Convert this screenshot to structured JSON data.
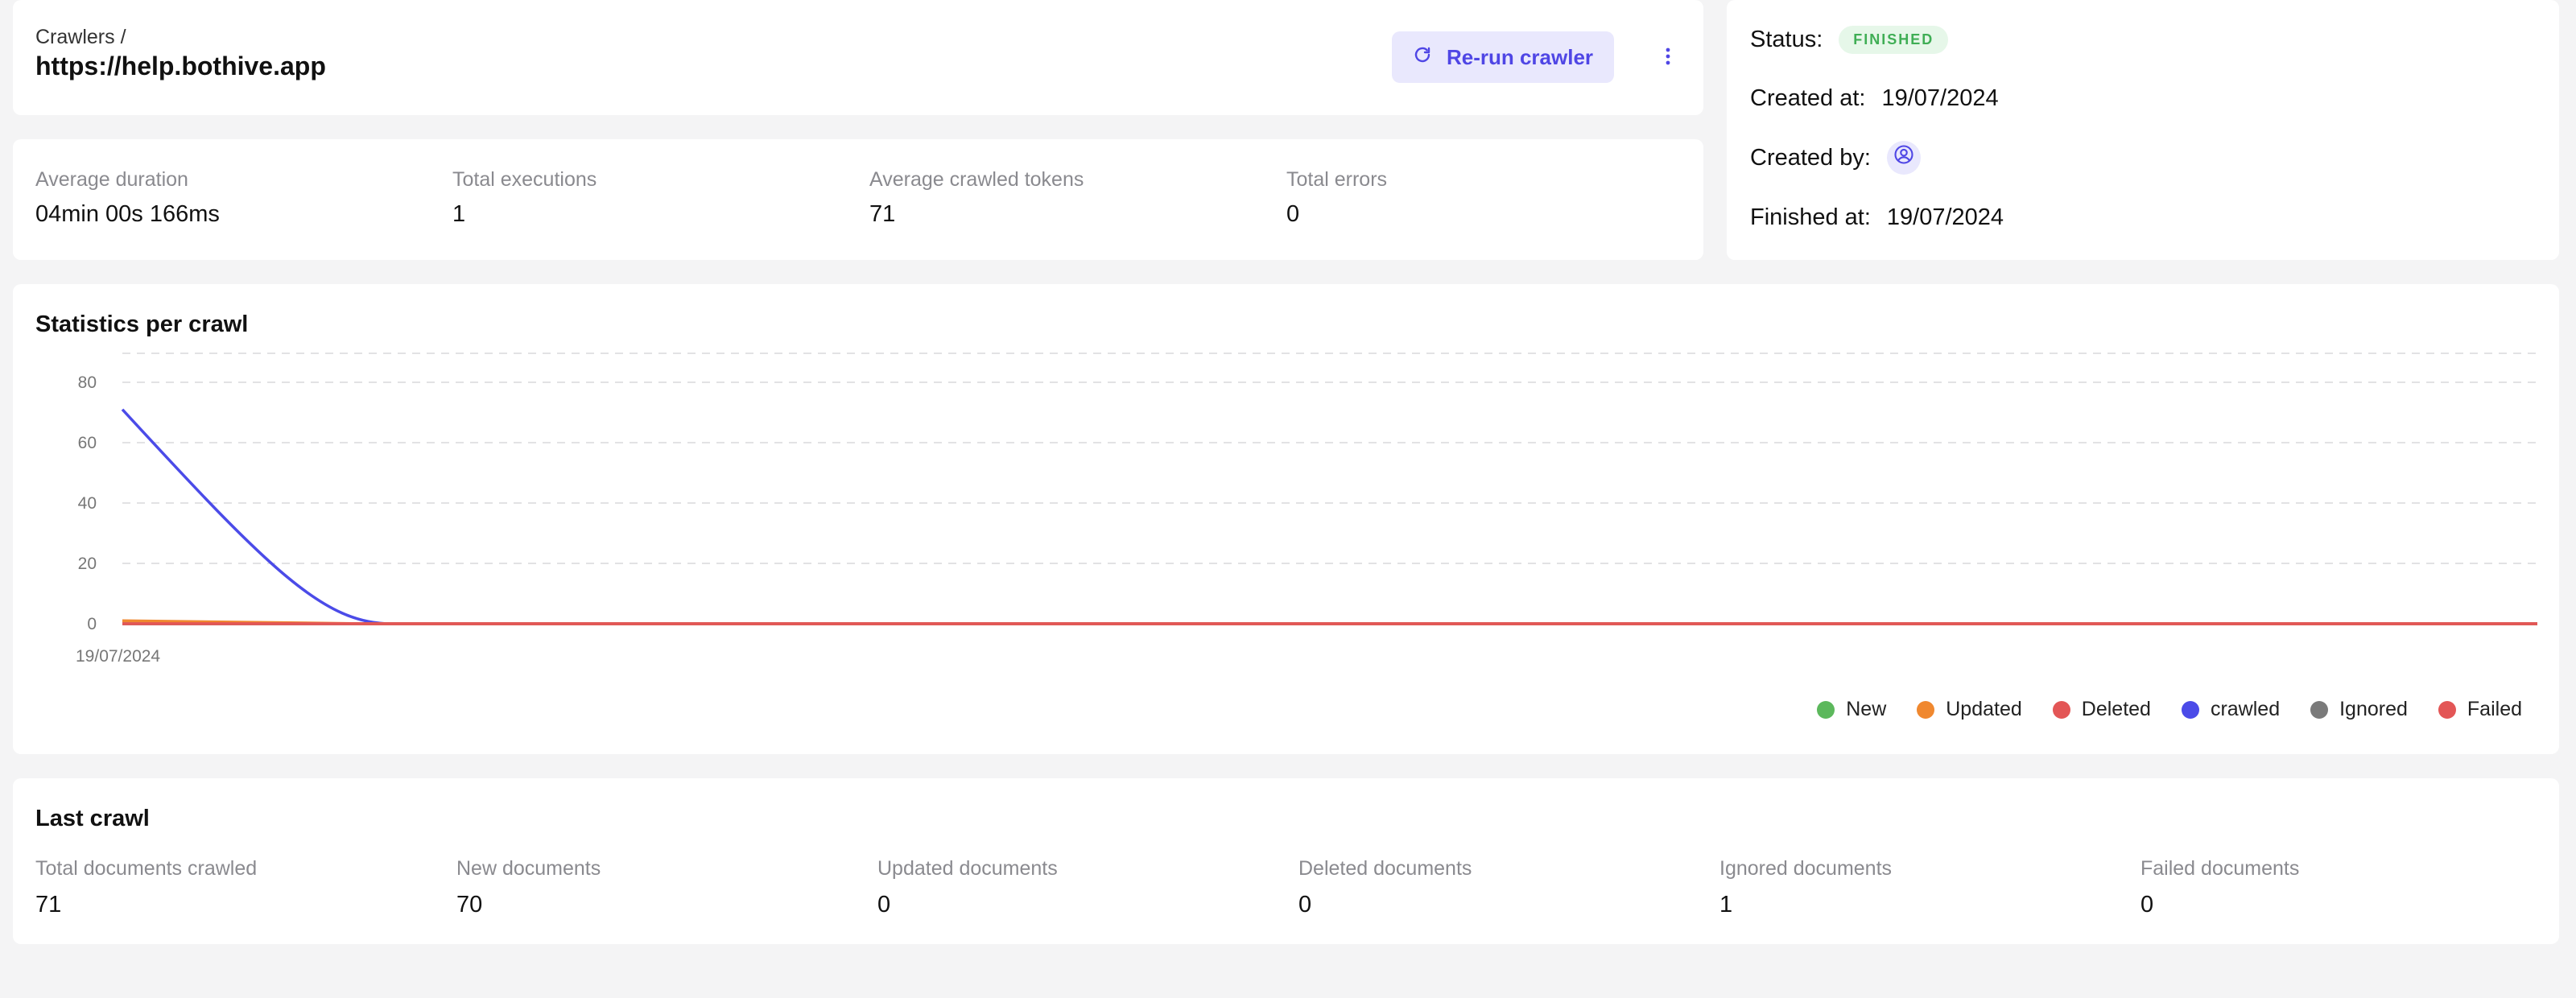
{
  "header": {
    "breadcrumb": "Crawlers /",
    "title": "https://help.bothive.app",
    "rerun_label": "Re-run crawler"
  },
  "stats": [
    {
      "label": "Average duration",
      "value": "04min 00s 166ms"
    },
    {
      "label": "Total executions",
      "value": "1"
    },
    {
      "label": "Average crawled tokens",
      "value": "71"
    },
    {
      "label": "Total errors",
      "value": "0"
    }
  ],
  "status_panel": {
    "status_label": "Status:",
    "status_value": "FINISHED",
    "created_at_label": "Created at:",
    "created_at_value": "19/07/2024",
    "created_by_label": "Created by:",
    "finished_at_label": "Finished at:",
    "finished_at_value": "19/07/2024"
  },
  "chart_data": {
    "type": "line",
    "title": "Statistics per crawl",
    "xlabel": "",
    "ylabel": "",
    "x": [
      "19/07/2024"
    ],
    "ylim": [
      0,
      88
    ],
    "yticks": [
      0,
      20,
      40,
      60,
      80
    ],
    "grid": true,
    "legend_placement": "bottom-right",
    "series": [
      {
        "name": "New",
        "color": "#5cb85c",
        "values": [
          0
        ]
      },
      {
        "name": "Updated",
        "color": "#f0882f",
        "values": [
          1
        ]
      },
      {
        "name": "Deleted",
        "color": "#e35656",
        "values": [
          0
        ]
      },
      {
        "name": "crawled",
        "color": "#4b4be8",
        "values": [
          71
        ]
      },
      {
        "name": "Ignored",
        "color": "#7a7a7a",
        "values": [
          0
        ]
      },
      {
        "name": "Failed",
        "color": "#e35656",
        "values": [
          0
        ]
      }
    ]
  },
  "last_crawl": {
    "title": "Last crawl",
    "items": [
      {
        "label": "Total documents crawled",
        "value": "71"
      },
      {
        "label": "New documents",
        "value": "70"
      },
      {
        "label": "Updated documents",
        "value": "0"
      },
      {
        "label": "Deleted documents",
        "value": "0"
      },
      {
        "label": "Ignored documents",
        "value": "1"
      },
      {
        "label": "Failed documents",
        "value": "0"
      }
    ]
  },
  "icons": {
    "rerun": "refresh-icon",
    "more": "more-vertical-icon",
    "avatar": "user-circle-icon"
  },
  "colors": {
    "accent": "#4f46e5",
    "accent_bg": "#e9e8fd",
    "success": "#3fae55",
    "success_bg": "#e6f7e9"
  }
}
